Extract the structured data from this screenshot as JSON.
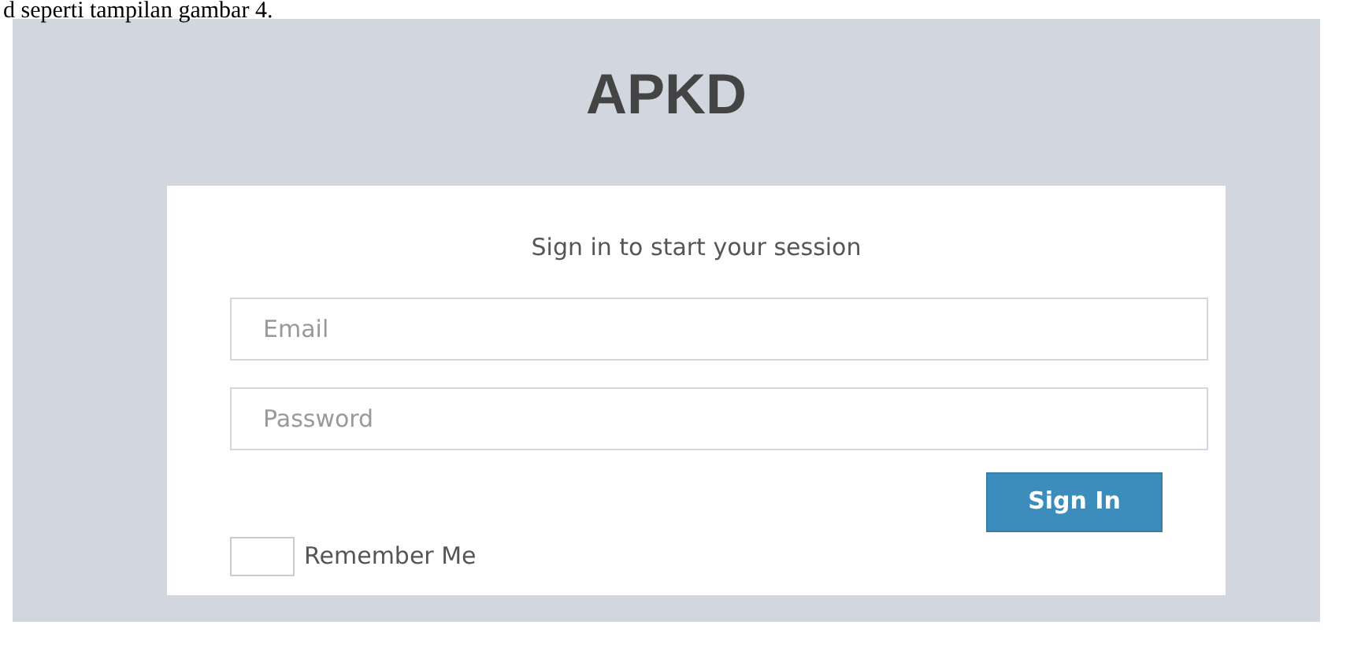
{
  "document_text": "d seperti tampilan gambar 4.",
  "app_title": "APKD",
  "login_box": {
    "message": "Sign in to start your session",
    "fields": [
      {
        "placeholder": "Email"
      },
      {
        "placeholder": "Password"
      }
    ],
    "remember": {
      "label": "Remember Me",
      "checked": false
    },
    "button": "Sign In"
  }
}
